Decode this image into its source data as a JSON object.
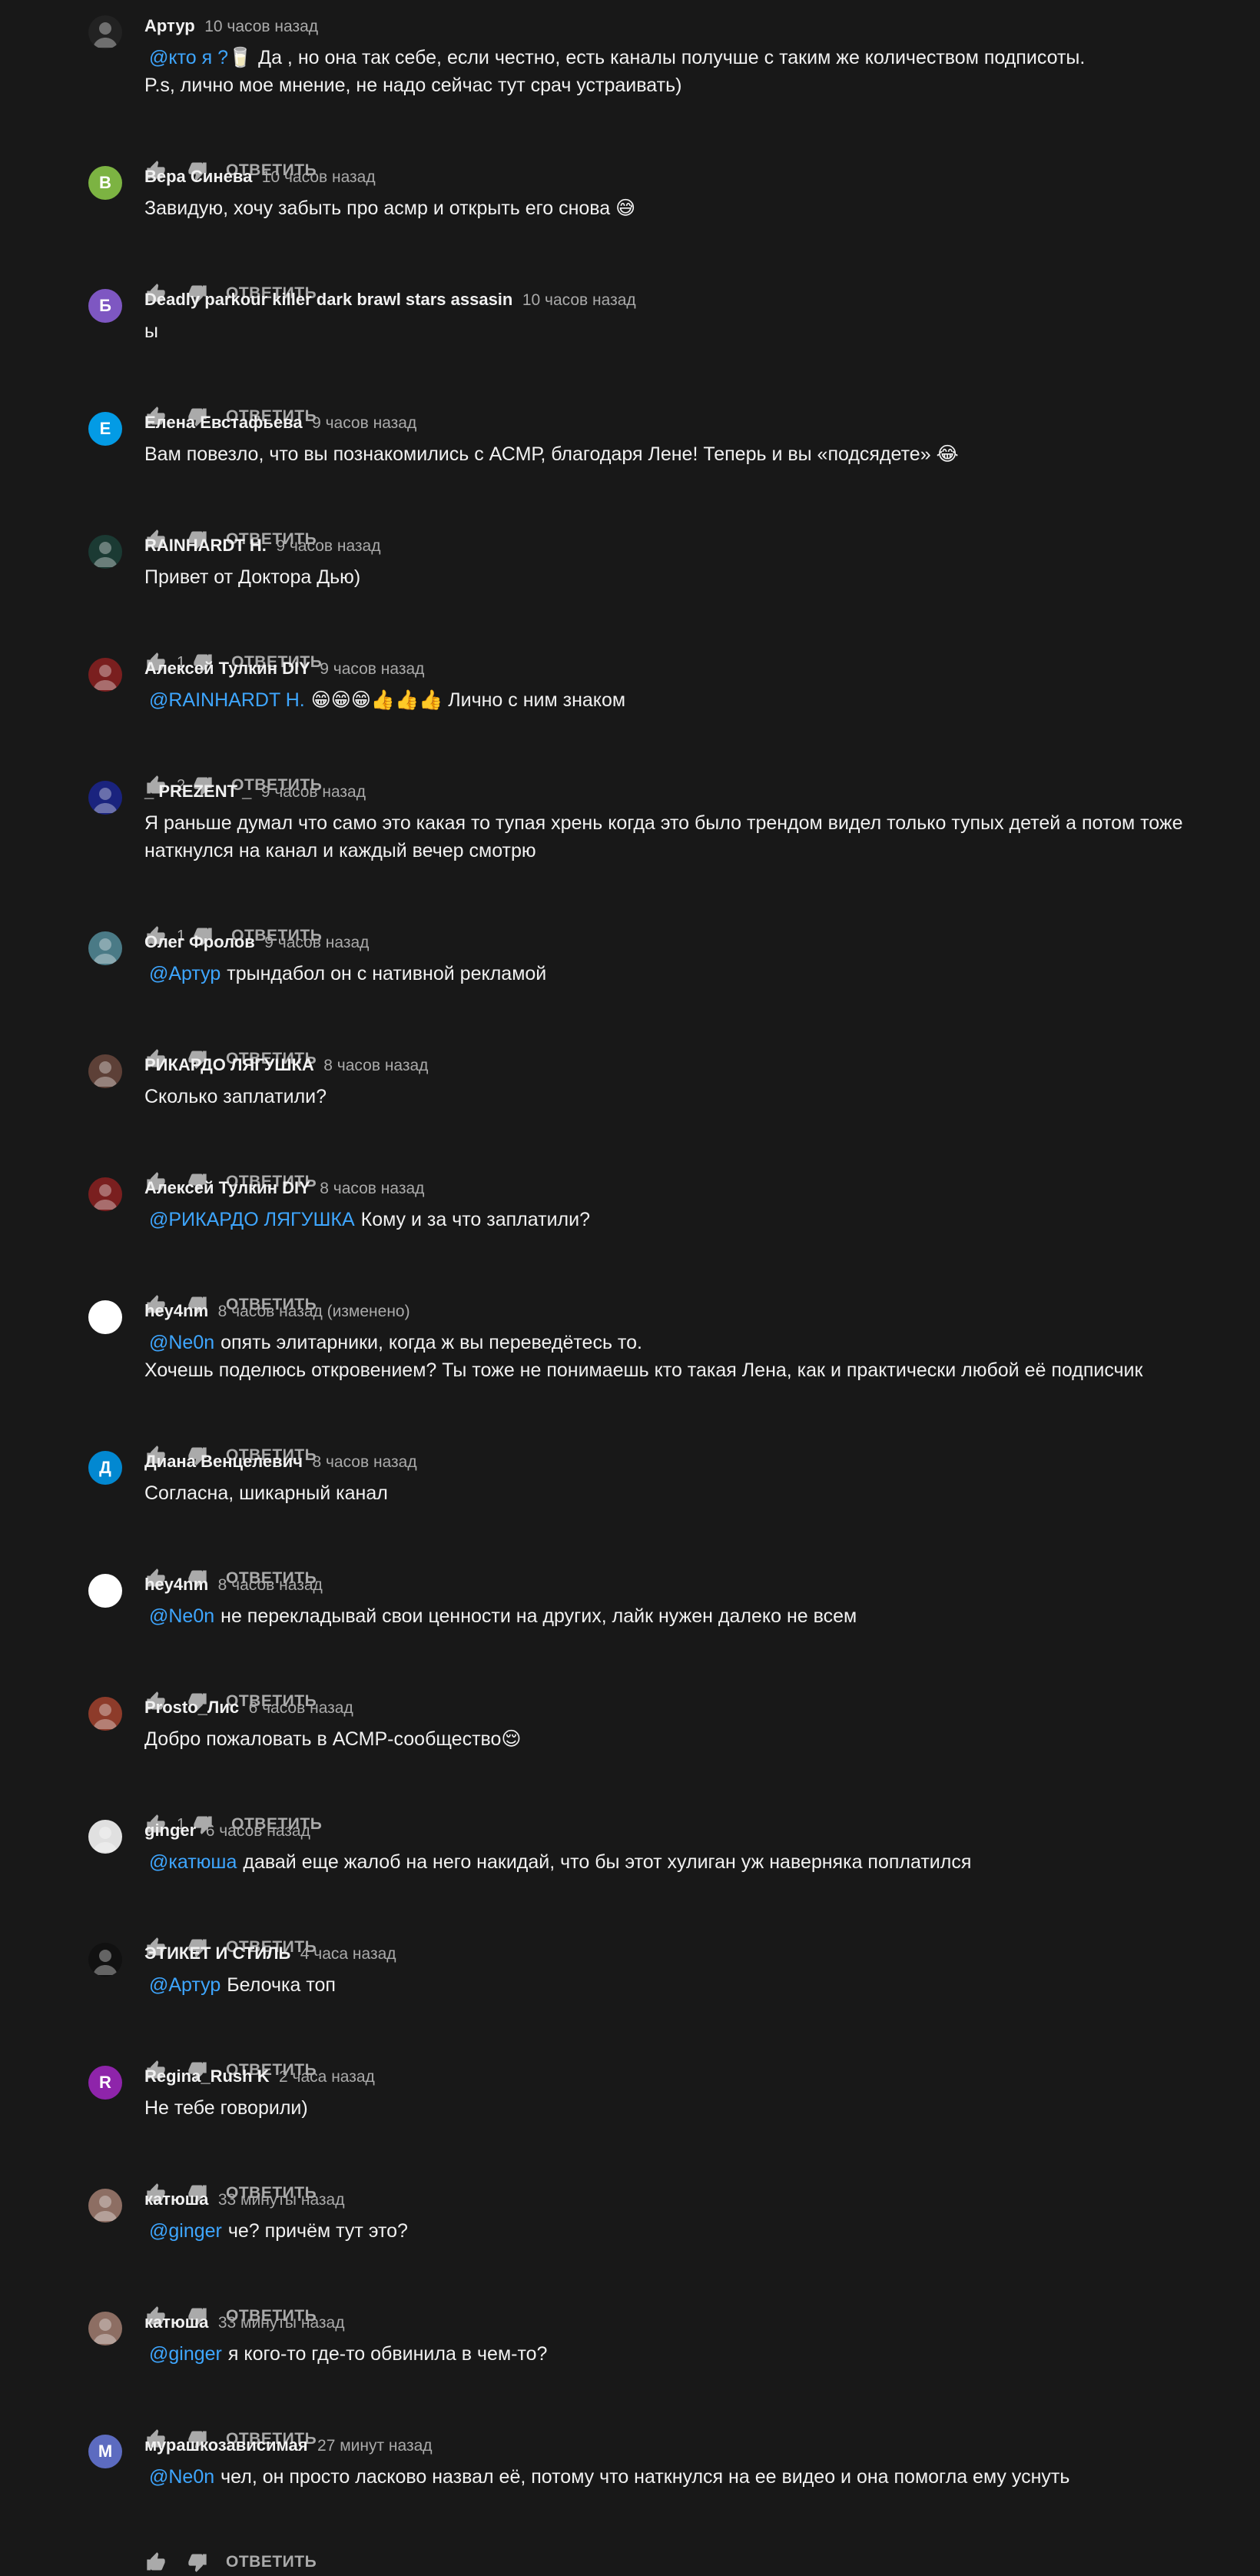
{
  "ui": {
    "reply_label": "ОТВЕТИТЬ"
  },
  "comments": [
    {
      "author": "Артур",
      "time": "10 часов назад",
      "mention": "@кто я ?🥛",
      "lines": [
        "Да , но она так себе, если честно, есть каналы получше с таким же количеством подписоты.",
        "P.s, лично мое мнение, не надо сейчас тут срач устраивать)"
      ],
      "likes": "",
      "avatar": {
        "type": "pic",
        "color": "#222222",
        "letter": ""
      }
    },
    {
      "author": "Вера Синева",
      "time": "10 часов назад",
      "mention": "",
      "lines": [
        "Завидую, хочу забыть про асмр и открыть его снова 😅"
      ],
      "likes": "",
      "avatar": {
        "type": "letter",
        "color": "#7cb342",
        "letter": "В"
      }
    },
    {
      "author": "Deadly parkour killer dark brawl stars assasin",
      "time": "10 часов назад",
      "mention": "",
      "lines": [
        "ы"
      ],
      "likes": "",
      "avatar": {
        "type": "letter",
        "color": "#7e57c2",
        "letter": "Б"
      }
    },
    {
      "author": "Елена Евстафьева",
      "time": "9 часов назад",
      "mention": "",
      "lines": [
        "Вам повезло, что вы познакомились с АСМР,  благодаря Лене! Теперь и вы «подсядете» 😂"
      ],
      "likes": "",
      "avatar": {
        "type": "letter",
        "color": "#039be5",
        "letter": "Е"
      }
    },
    {
      "author": "RAINHARDT H.",
      "time": "9 часов назад",
      "mention": "",
      "lines": [
        "Привет от Доктора Дью)"
      ],
      "likes": "1",
      "avatar": {
        "type": "pic",
        "color": "#1b3a33",
        "letter": ""
      }
    },
    {
      "author": "Алексей Тулкин DIY",
      "time": "9 часов назад",
      "mention": "@RAINHARDT H.",
      "lines": [
        "😁😁😁👍👍👍 Лично с ним знаком"
      ],
      "likes": "2",
      "avatar": {
        "type": "pic",
        "color": "#7a1f1f",
        "letter": ""
      }
    },
    {
      "author": "_ PREZENT _",
      "time": "9 часов назад",
      "mention": "",
      "lines": [
        "Я раньше думал что само это какая то тупая хрень когда это было трендом видел только тупых детей а потом тоже",
        "наткнулся на канал и каждый вечер смотрю"
      ],
      "likes": "1",
      "avatar": {
        "type": "pic",
        "color": "#1a237e",
        "letter": ""
      }
    },
    {
      "author": "Олег Фролов",
      "time": "9 часов назад",
      "mention": "@Артур",
      "lines": [
        "трындабол он с нативной рекламой"
      ],
      "likes": "",
      "avatar": {
        "type": "pic",
        "color": "#4a7a86",
        "letter": ""
      }
    },
    {
      "author": "РИКАРДО ЛЯГУШКА",
      "time": "8 часов назад",
      "mention": "",
      "lines": [
        "Сколько заплатили?"
      ],
      "likes": "",
      "avatar": {
        "type": "pic",
        "color": "#5d4037",
        "letter": ""
      }
    },
    {
      "author": "Алексей Тулкин DIY",
      "time": "8 часов назад",
      "mention": "@РИКАРДО ЛЯГУШКА",
      "lines": [
        "Кому и за что заплатили?"
      ],
      "likes": "",
      "avatar": {
        "type": "pic",
        "color": "#7a1f1f",
        "letter": ""
      }
    },
    {
      "author": "hey4nm",
      "time": "8 часов назад (изменено)",
      "mention": "@Ne0n",
      "lines": [
        "опять элитарники, когда ж вы переведётесь то.",
        "Хочешь поделюсь откровением? Ты тоже не понимаешь кто такая Лена, как и практически любой её подписчик"
      ],
      "likes": "",
      "avatar": {
        "type": "pic",
        "color": "#ffffff",
        "letter": ""
      }
    },
    {
      "author": "Диана Венцелевич",
      "time": "8 часов назад",
      "mention": "",
      "lines": [
        "Согласна, шикарный канал"
      ],
      "likes": "",
      "avatar": {
        "type": "letter",
        "color": "#0288d1",
        "letter": "Д"
      }
    },
    {
      "author": "hey4nm",
      "time": "8 часов назад",
      "mention": "@Ne0n",
      "lines": [
        "не перекладывай свои ценности на других, лайк нужен далеко не всем"
      ],
      "likes": "",
      "avatar": {
        "type": "pic",
        "color": "#ffffff",
        "letter": ""
      }
    },
    {
      "author": "Prosto_Лис",
      "time": "6 часов назад",
      "mention": "",
      "lines": [
        "Добро пожаловать в АСМР-сообщество😌"
      ],
      "likes": "1",
      "avatar": {
        "type": "pic",
        "color": "#8d3b2a",
        "letter": ""
      }
    },
    {
      "author": "ginger",
      "time": "6 часов назад",
      "mention": "@катюша",
      "lines": [
        "давай еще жалоб на него накидай, что бы этот хулиган уж наверняка поплатился"
      ],
      "likes": "",
      "avatar": {
        "type": "pic",
        "color": "#e0e0e0",
        "letter": ""
      }
    },
    {
      "author": "ЭТИКЕТ И СТИЛЬ",
      "time": "4 часа назад",
      "mention": "@Артур",
      "lines": [
        "Белочка топ"
      ],
      "likes": "",
      "avatar": {
        "type": "pic",
        "color": "#111111",
        "letter": ""
      }
    },
    {
      "author": "Regina_Rush K",
      "time": "2 часа назад",
      "mention": "",
      "lines": [
        "Не тебе говорили)"
      ],
      "likes": "",
      "avatar": {
        "type": "letter",
        "color": "#8e24aa",
        "letter": "R"
      }
    },
    {
      "author": "катюша",
      "time": "33 минуты назад",
      "mention": "@ginger",
      "lines": [
        "че? причём тут это?"
      ],
      "likes": "",
      "avatar": {
        "type": "pic",
        "color": "#8d6e63",
        "letter": ""
      }
    },
    {
      "author": "катюша",
      "time": "33 минуты назад",
      "mention": "@ginger",
      "lines": [
        "я кого-то где-то обвинила в чем-то?"
      ],
      "likes": "",
      "avatar": {
        "type": "pic",
        "color": "#8d6e63",
        "letter": ""
      }
    },
    {
      "author": "мурашкозависимая",
      "time": "27 минут назад",
      "mention": "@Ne0n",
      "lines": [
        "чел, он просто ласково назвал её, потому что наткнулся на ее видео и она помогла ему уснуть"
      ],
      "likes": "",
      "avatar": {
        "type": "letter",
        "color": "#5c6bc0",
        "letter": "М"
      }
    }
  ]
}
